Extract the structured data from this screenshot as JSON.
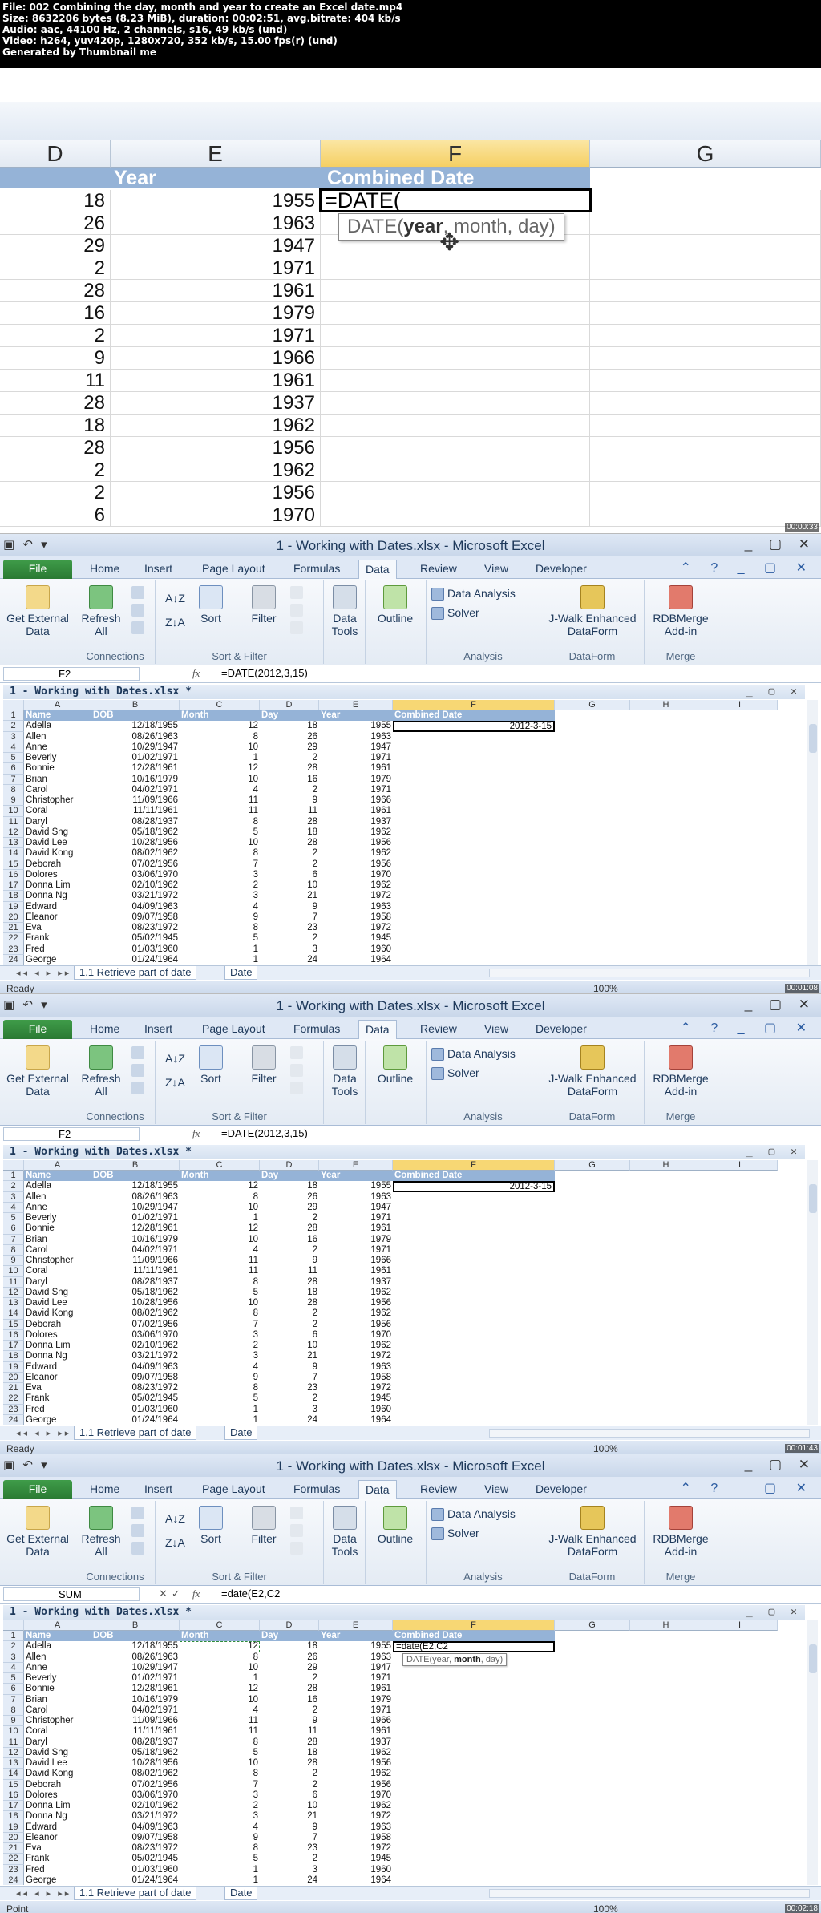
{
  "info": {
    "line1": "File: 002 Combining the day, month and year to create an Excel date.mp4",
    "line2": "Size: 8632206 bytes (8.23 MiB), duration: 00:02:51, avg.bitrate: 404 kb/s",
    "line3": "Audio: aac, 44100 Hz, 2 channels, s16, 49 kb/s (und)",
    "line4": "Video: h264, yuv420p, 1280x720, 352 kb/s, 15.00 fps(r) (und)",
    "line5": "Generated by Thumbnail me"
  },
  "zoom": {
    "columns": [
      "D",
      "E",
      "F",
      "G"
    ],
    "headers": {
      "year": "Year",
      "combined": "Combined Date"
    },
    "formula": "=DATE(",
    "tooltip": {
      "fn": "DATE(",
      "bold": "year",
      "rest": ", month, day)"
    },
    "rows": [
      {
        "d": "18",
        "e": "1955"
      },
      {
        "d": "26",
        "e": "1963"
      },
      {
        "d": "29",
        "e": "1947"
      },
      {
        "d": "2",
        "e": "1971"
      },
      {
        "d": "28",
        "e": "1961"
      },
      {
        "d": "16",
        "e": "1979"
      },
      {
        "d": "2",
        "e": "1971"
      },
      {
        "d": "9",
        "e": "1966"
      },
      {
        "d": "11",
        "e": "1961"
      },
      {
        "d": "28",
        "e": "1937"
      },
      {
        "d": "18",
        "e": "1962"
      },
      {
        "d": "28",
        "e": "1956"
      },
      {
        "d": "2",
        "e": "1962"
      },
      {
        "d": "2",
        "e": "1956"
      },
      {
        "d": "6",
        "e": "1970"
      }
    ],
    "timestamp": "00:00:33"
  },
  "excel": {
    "title": "1 - Working with Dates.xlsx - Microsoft Excel",
    "tabs": [
      "File",
      "Home",
      "Insert",
      "Page Layout",
      "Formulas",
      "Data",
      "Review",
      "View",
      "Developer"
    ],
    "ribbon": {
      "get_external": "Get External Data",
      "refresh": "Refresh All",
      "connections": "Connections",
      "sort": "Sort",
      "filter": "Filter",
      "sort_filter": "Sort & Filter",
      "data_tools": "Data Tools",
      "outline": "Outline",
      "data_analysis": "Data Analysis",
      "solver": "Solver",
      "analysis": "Analysis",
      "jwalk": "J-Walk Enhanced DataForm",
      "dataform": "DataForm",
      "rdb": "RDBMerge Add-in",
      "merge": "Merge"
    },
    "workbook": "1 - Working with Dates.xlsx *",
    "columns": [
      "A",
      "B",
      "C",
      "D",
      "E",
      "F",
      "G",
      "H",
      "I"
    ],
    "headers": [
      "Name",
      "DOB",
      "Month",
      "Day",
      "Year",
      "Combined Date"
    ],
    "rows": [
      [
        "Adella",
        "12/18/1955",
        "12",
        "18",
        "1955"
      ],
      [
        "Allen",
        "08/26/1963",
        "8",
        "26",
        "1963"
      ],
      [
        "Anne",
        "10/29/1947",
        "10",
        "29",
        "1947"
      ],
      [
        "Beverly",
        "01/02/1971",
        "1",
        "2",
        "1971"
      ],
      [
        "Bonnie",
        "12/28/1961",
        "12",
        "28",
        "1961"
      ],
      [
        "Brian",
        "10/16/1979",
        "10",
        "16",
        "1979"
      ],
      [
        "Carol",
        "04/02/1971",
        "4",
        "2",
        "1971"
      ],
      [
        "Christopher",
        "11/09/1966",
        "11",
        "9",
        "1966"
      ],
      [
        "Coral",
        "11/11/1961",
        "11",
        "11",
        "1961"
      ],
      [
        "Daryl",
        "08/28/1937",
        "8",
        "28",
        "1937"
      ],
      [
        "David Sng",
        "05/18/1962",
        "5",
        "18",
        "1962"
      ],
      [
        "David Lee",
        "10/28/1956",
        "10",
        "28",
        "1956"
      ],
      [
        "David Kong",
        "08/02/1962",
        "8",
        "2",
        "1962"
      ],
      [
        "Deborah",
        "07/02/1956",
        "7",
        "2",
        "1956"
      ],
      [
        "Dolores",
        "03/06/1970",
        "3",
        "6",
        "1970"
      ],
      [
        "Donna Lim",
        "02/10/1962",
        "2",
        "10",
        "1962"
      ],
      [
        "Donna Ng",
        "03/21/1972",
        "3",
        "21",
        "1972"
      ],
      [
        "Edward",
        "04/09/1963",
        "4",
        "9",
        "1963"
      ],
      [
        "Eleanor",
        "09/07/1958",
        "9",
        "7",
        "1958"
      ],
      [
        "Eva",
        "08/23/1972",
        "8",
        "23",
        "1972"
      ],
      [
        "Frank",
        "05/02/1945",
        "5",
        "2",
        "1945"
      ],
      [
        "Fred",
        "01/03/1960",
        "1",
        "3",
        "1960"
      ],
      [
        "George",
        "01/24/1964",
        "1",
        "24",
        "1964"
      ]
    ],
    "sheet_tabs": [
      "1.1 Retrieve part of date",
      "Date"
    ],
    "status_ready": "Ready",
    "status_point": "Point",
    "zoom_level": "100%"
  },
  "windows": [
    {
      "namebox": "F2",
      "formula": "=DATE(2012,3,15)",
      "f2": "2012-3-15",
      "timestamp": "00:01:08"
    },
    {
      "namebox": "F2",
      "formula": "=DATE(2012,3,15)",
      "f2": "2012-3-15",
      "timestamp": "00:01:43"
    },
    {
      "namebox": "SUM",
      "formula": "=date(E2,C2",
      "f2": "=date(E2,C2",
      "tooltip_fn": "DATE(year, ",
      "tooltip_bold": "month",
      "tooltip_rest": ", day)",
      "timestamp": "00:02:18"
    }
  ]
}
